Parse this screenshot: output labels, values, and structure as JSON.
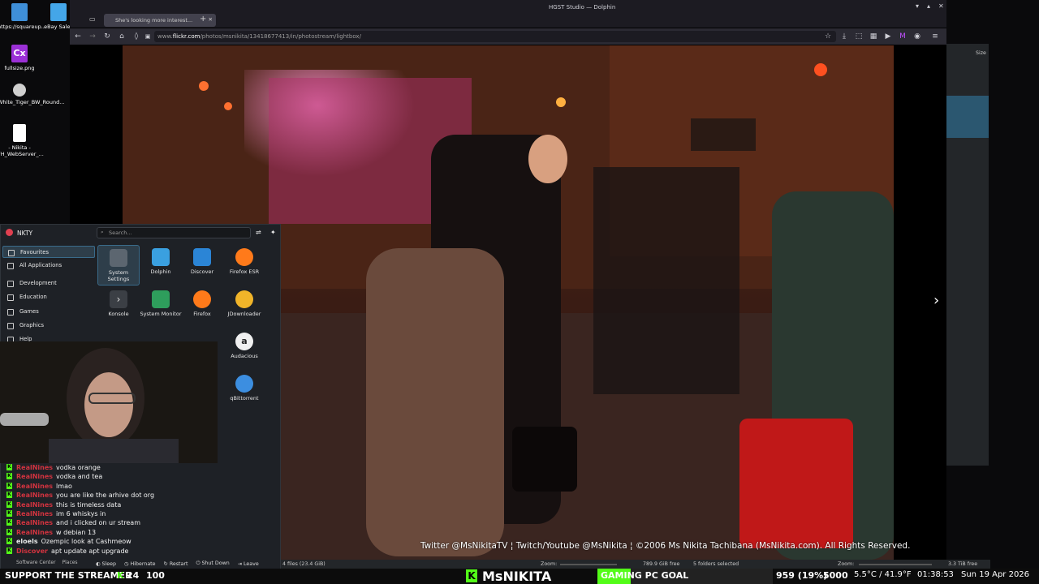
{
  "window": {
    "title": "HGST Studio — Dolphin"
  },
  "desktop_icons": [
    {
      "label": "https://squareup...",
      "color": "#3f8fd8"
    },
    {
      "label": "eBay Sales",
      "color": "#44a6e8"
    },
    {
      "label": "fullsize.png",
      "color": "#9b30d6"
    },
    {
      "label": "White_Tiger_BW_Round...",
      "color": "#cfcfcf"
    },
    {
      "label": "- Nikita - FH_WebServer_...",
      "color": "#ffffff"
    }
  ],
  "browser": {
    "tab_title": "She's looking more interest...",
    "url_prefix": "www.",
    "url_host": "flickr.com",
    "url_path": "/photos/msnikita/13418677413/in/photostream/lightbox/",
    "credit": "Twitter @MsNikitaTV ¦ Twitch/Youtube @MsNikita ¦ ©2006 Ms Nikita Tachibana (MsNikita.com). All Rights Reserved."
  },
  "start_menu": {
    "user": "NKTY",
    "search_placeholder": "Search...",
    "categories": [
      {
        "label": "Favourites",
        "selected": true
      },
      {
        "label": "All Applications",
        "selected": false
      },
      {
        "label": "Development",
        "selected": false
      },
      {
        "label": "Education",
        "selected": false
      },
      {
        "label": "Games",
        "selected": false
      },
      {
        "label": "Graphics",
        "selected": false
      },
      {
        "label": "Help",
        "selected": false
      }
    ],
    "apps": [
      {
        "label": "System Settings",
        "icon": "settings-icon",
        "color": "#5c6670"
      },
      {
        "label": "Dolphin",
        "icon": "folder-icon",
        "color": "#3aa0e0"
      },
      {
        "label": "Discover",
        "icon": "shopping-bag-icon",
        "color": "#2b85d6"
      },
      {
        "label": "Firefox ESR",
        "icon": "firefox-icon",
        "color": "#ff7a1a"
      },
      {
        "label": "Konsole",
        "icon": "terminal-icon",
        "color": "#3b3f45"
      },
      {
        "label": "System Monitor",
        "icon": "monitor-chart-icon",
        "color": "#2e9e5c"
      },
      {
        "label": "Firefox",
        "icon": "firefox-icon",
        "color": "#ff7a1a"
      },
      {
        "label": "JDownloader",
        "icon": "jdownloader-icon",
        "color": "#f0b429"
      },
      {
        "label": "Audacious",
        "icon": "audacious-icon",
        "color": "#f0f0f0"
      },
      {
        "label": "qBittorrent",
        "icon": "qbittorrent-icon",
        "color": "#3c8ee0"
      }
    ],
    "footer": {
      "software_center": "Software Center",
      "places": "Places",
      "sleep": "Sleep",
      "hibernate": "Hibernate",
      "restart": "Restart",
      "shutdown": "Shut Down",
      "leave": "Leave"
    }
  },
  "chat": [
    {
      "user": "RealNines",
      "msg": "vodka orange",
      "color": "#d2333f"
    },
    {
      "user": "RealNines",
      "msg": "vodka and tea",
      "color": "#d2333f"
    },
    {
      "user": "RealNines",
      "msg": "lmao",
      "color": "#d2333f"
    },
    {
      "user": "RealNines",
      "msg": "you are like the arhive dot org",
      "color": "#d2333f"
    },
    {
      "user": "RealNines",
      "msg": "this is timeless data",
      "color": "#d2333f"
    },
    {
      "user": "RealNines",
      "msg": "im 6 whiskys in",
      "color": "#d2333f"
    },
    {
      "user": "RealNines",
      "msg": "and i clicked on ur stream",
      "color": "#d2333f"
    },
    {
      "user": "RealNines",
      "msg": "w debian 13",
      "color": "#d2333f"
    },
    {
      "user": "eloels",
      "msg": "Ozempic look at Cashmeow",
      "color": "#e8e8e8"
    },
    {
      "user": "Discover",
      "msg": "apt update apt upgrade",
      "color": "#d2333f"
    }
  ],
  "dolphin_status": {
    "files": "4 files (23.4 GiB)",
    "zoom1": "Zoom:",
    "free1": "789.9 GiB free",
    "selected": "5 folders selected",
    "zoom2": "Zoom:",
    "free2": "3.3 TiB free",
    "size_header": "Size"
  },
  "bottom_bar": {
    "support": "SUPPORT THE STREAMER",
    "count1": "24",
    "count2": "100",
    "brand": "MsNIKITA",
    "goal": "GAMING PC GOAL",
    "goal_value": "959 (19%)",
    "goal_target": "5000",
    "goal_fraction": 0.19,
    "temps": "5.5°C / 41.9°F",
    "time": "01:38:53",
    "date": "Sun 19 Apr 2026"
  }
}
